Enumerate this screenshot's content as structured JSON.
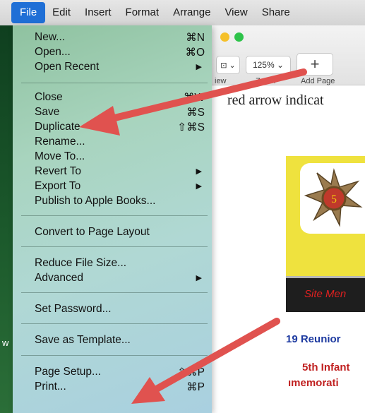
{
  "menubar": {
    "items": [
      "File",
      "Edit",
      "Insert",
      "Format",
      "Arrange",
      "View",
      "Share"
    ]
  },
  "file_menu": {
    "new": {
      "label": "New...",
      "shortcut": "⌘N"
    },
    "open": {
      "label": "Open...",
      "shortcut": "⌘O"
    },
    "open_recent": {
      "label": "Open Recent"
    },
    "close": {
      "label": "Close",
      "shortcut": "⌘W"
    },
    "save": {
      "label": "Save",
      "shortcut": "⌘S"
    },
    "duplicate": {
      "label": "Duplicate",
      "shortcut": "⇧⌘S"
    },
    "rename": {
      "label": "Rename..."
    },
    "move_to": {
      "label": "Move To..."
    },
    "revert_to": {
      "label": "Revert To"
    },
    "export_to": {
      "label": "Export To"
    },
    "publish": {
      "label": "Publish to Apple Books..."
    },
    "convert": {
      "label": "Convert to Page Layout"
    },
    "reduce": {
      "label": "Reduce File Size..."
    },
    "advanced": {
      "label": "Advanced"
    },
    "set_password": {
      "label": "Set Password..."
    },
    "save_template": {
      "label": "Save as Template..."
    },
    "page_setup": {
      "label": "Page Setup...",
      "shortcut": "⇧⌘P"
    },
    "print": {
      "label": "Print...",
      "shortcut": "⌘P"
    },
    "submenu_arrow": "▶"
  },
  "toolbar": {
    "view_value": "⊡ ⌄",
    "zoom_value": "125% ⌄",
    "add_symbol": "+",
    "view_label": "iew",
    "zoom_label": "Zoom",
    "add_label": "Add Page"
  },
  "document": {
    "text": "red arrow indicat",
    "flyer_bar_text": "Site Men",
    "reunion_text": "19 Reunior",
    "infantry_text": "5th Infant",
    "commem_text": "ımemorati",
    "emblem_number": "5",
    "left_glyph": "w"
  },
  "colors": {
    "menu_highlight": "#1f6fd6",
    "arrow": "#e0524f",
    "traffic_yellow": "#f5c02a",
    "traffic_green": "#2ec34a"
  }
}
